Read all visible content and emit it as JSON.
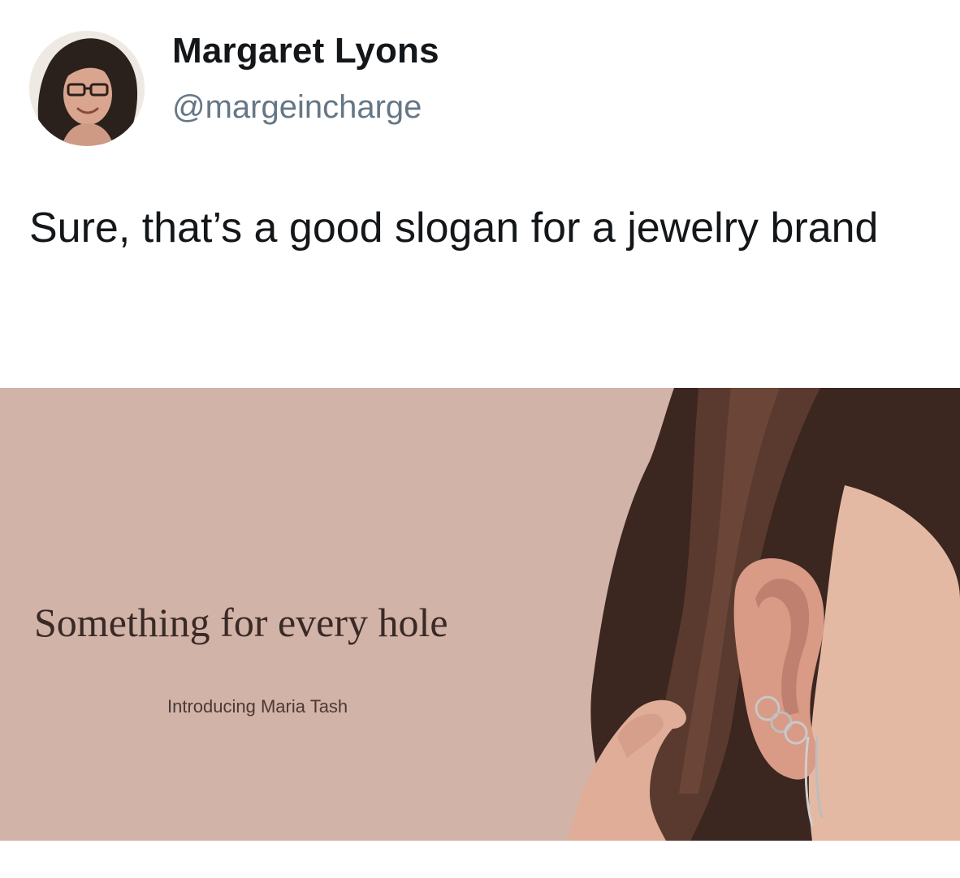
{
  "tweet": {
    "author_name": "Margaret Lyons",
    "author_handle": "@margeincharge",
    "text": "Sure, that’s a good slogan for a jewelry brand"
  },
  "ad_image": {
    "slogan": "Something for every hole",
    "subline": "Introducing Maria Tash",
    "background_color": "#d2b3a8"
  },
  "colors": {
    "text_primary": "#14171a",
    "text_secondary": "#657786"
  }
}
